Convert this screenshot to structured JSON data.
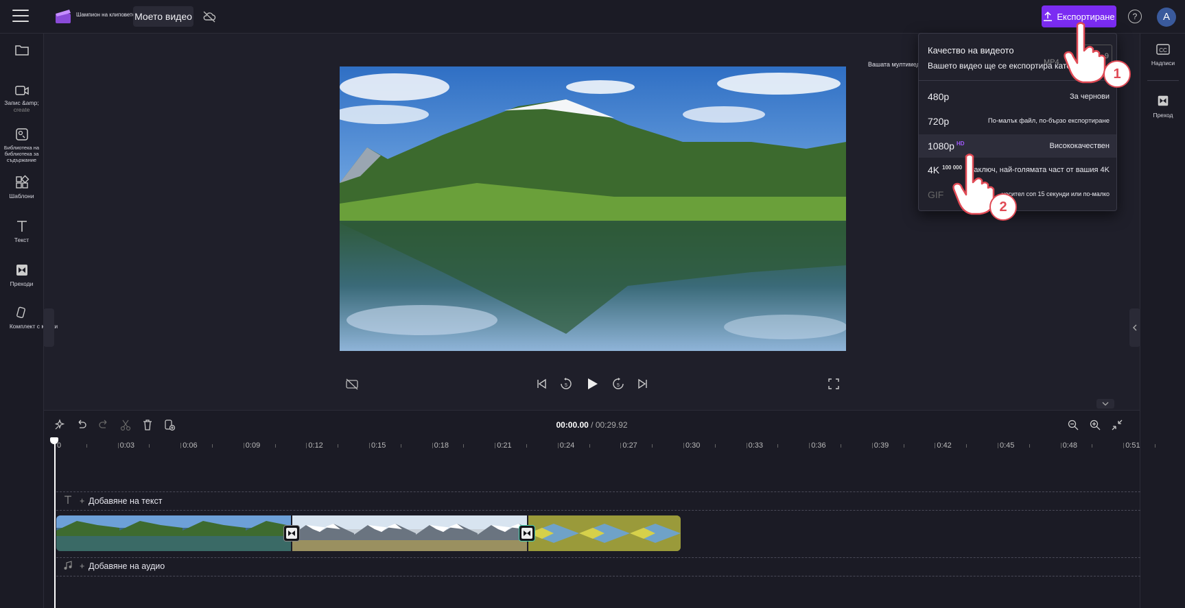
{
  "topbar": {
    "brand": "Шампион на клиповете",
    "project_name": "Моето видео",
    "export_label": "Експортиране",
    "help": "?",
    "avatar_initial": "A"
  },
  "left_sidebar": {
    "items": [
      {
        "label": "",
        "icon": "folder-icon"
      },
      {
        "label": "Запис &amp;",
        "sub": "create",
        "icon": "camera-icon"
      },
      {
        "label": "Библиотека на библиотека за съдържание",
        "icon": "library-icon"
      },
      {
        "label": "Шаблони",
        "icon": "templates-icon"
      },
      {
        "label": "Текст",
        "icon": "text-icon"
      },
      {
        "label": "Преходи",
        "icon": "transitions-icon"
      },
      {
        "label": "Комплект с марки",
        "icon": "brand-kit-icon"
      }
    ]
  },
  "right_sidebar": {
    "captions_label": "Надписи",
    "transition_label": "Преход"
  },
  "media_label": "Вашата мултимедия",
  "timeline": {
    "current_time": "00:00.00",
    "total_time": "/ 00:29.92",
    "ticks": [
      "0",
      "0:03",
      "0:06",
      "0:09",
      "0:12",
      "0:15",
      "0:18",
      "0:21",
      "0:24",
      "0:27",
      "0:30",
      "0:33",
      "0:36",
      "0:39",
      "0:42",
      "0:45",
      "0:48",
      "0:51"
    ],
    "add_text": "Добавяне на текст",
    "add_audio": "Добавяне на аудио"
  },
  "export_dropdown": {
    "title": "Качество на видеото",
    "subtitle": "Вашето видео ще се експортира като",
    "format": "MP4",
    "top_box": "9",
    "options": [
      {
        "res": "480p",
        "badge": "",
        "desc": "За чернови",
        "disabled": false
      },
      {
        "res": "720p",
        "badge": "",
        "desc": "По-малък файл, по-бързо експортиране",
        "disabled": false
      },
      {
        "res": "1080p",
        "badge": "HD",
        "desc": "Висококачествен",
        "disabled": false,
        "highlighted": true
      },
      {
        "res": "4K",
        "badge": "100 000",
        "desc": "Наключ, най-голямата част от вашия 4K",
        "disabled": false
      },
      {
        "res": "GIF",
        "badge": "",
        "desc": "носител соп 15 секунди или по-малко",
        "disabled": true
      }
    ]
  },
  "steps": [
    "1",
    "2"
  ],
  "colors": {
    "accent": "#7b2cf2",
    "hd_badge": "#a259ff",
    "step_ring": "#e04a55",
    "background": "#1f1f2a"
  }
}
